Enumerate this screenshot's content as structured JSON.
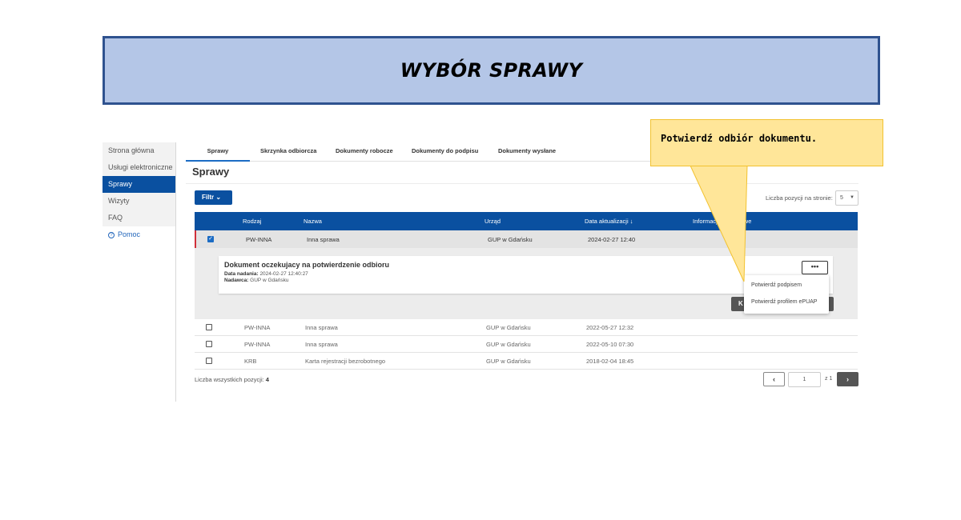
{
  "banner": {
    "title": "WYBÓR SPRAWY"
  },
  "sidebar": {
    "items": [
      {
        "label": "Strona główna"
      },
      {
        "label": "Usługi elektroniczne"
      },
      {
        "label": "Sprawy"
      },
      {
        "label": "Wizyty"
      },
      {
        "label": "FAQ"
      }
    ],
    "help": {
      "label": "Pomoc",
      "icon": "help-circle-icon"
    }
  },
  "tabs": [
    {
      "label": "Sprawy"
    },
    {
      "label": "Skrzynka odbiorcza"
    },
    {
      "label": "Dokumenty robocze"
    },
    {
      "label": "Dokumenty do podpisu"
    },
    {
      "label": "Dokumenty wysłane"
    }
  ],
  "page": {
    "title": "Sprawy"
  },
  "toolbar": {
    "filter_label": "Filtr",
    "per_page_label": "Liczba pozycji na stronie:",
    "per_page_value": "5"
  },
  "table": {
    "headers": [
      "Rodzaj",
      "Nazwa",
      "Urząd",
      "Data aktualizacji",
      "Informacje dodatkowe"
    ],
    "selected_row": {
      "rodzaj": "PW-INNA",
      "nazwa": "Inna sprawa",
      "urzad": "GUP w Gdańsku",
      "data": "2024-02-27 12:40"
    },
    "rows": [
      {
        "rodzaj": "PW-INNA",
        "nazwa": "Inna sprawa",
        "urzad": "GUP w Gdańsku",
        "data": "2022-05-27 12:32"
      },
      {
        "rodzaj": "PW-INNA",
        "nazwa": "Inna sprawa",
        "urzad": "GUP w Gdańsku",
        "data": "2022-05-10 07:30"
      },
      {
        "rodzaj": "KRB",
        "nazwa": "Karta rejestracji bezrobotnego",
        "urzad": "GUP w Gdańsku",
        "data": "2018-02-04 18:45"
      }
    ]
  },
  "document": {
    "title": "Dokument oczekujacy na potwierdzenie odbioru",
    "sent_label": "Data nadania:",
    "sent_value": "2024-02-27 12:40:27",
    "sender_label": "Nadawca:",
    "sender_value": "GUP w Gdańsku",
    "more_label": "•••",
    "dark_button_label": "K"
  },
  "dropdown": {
    "items": [
      {
        "label": "Potwierdź podpisem"
      },
      {
        "label": "Potwierdź profilem ePUAP"
      }
    ]
  },
  "footer": {
    "total_label": "Liczba wszystkich pozycji:",
    "total_value": "4",
    "page_value": "1",
    "page_of": "z 1"
  },
  "callout": {
    "text": "Potwierdź odbiór dokumentu."
  },
  "colors": {
    "primary": "#0a50a0",
    "banner_bg": "#b4c6e7",
    "callout_bg": "#ffe699"
  }
}
